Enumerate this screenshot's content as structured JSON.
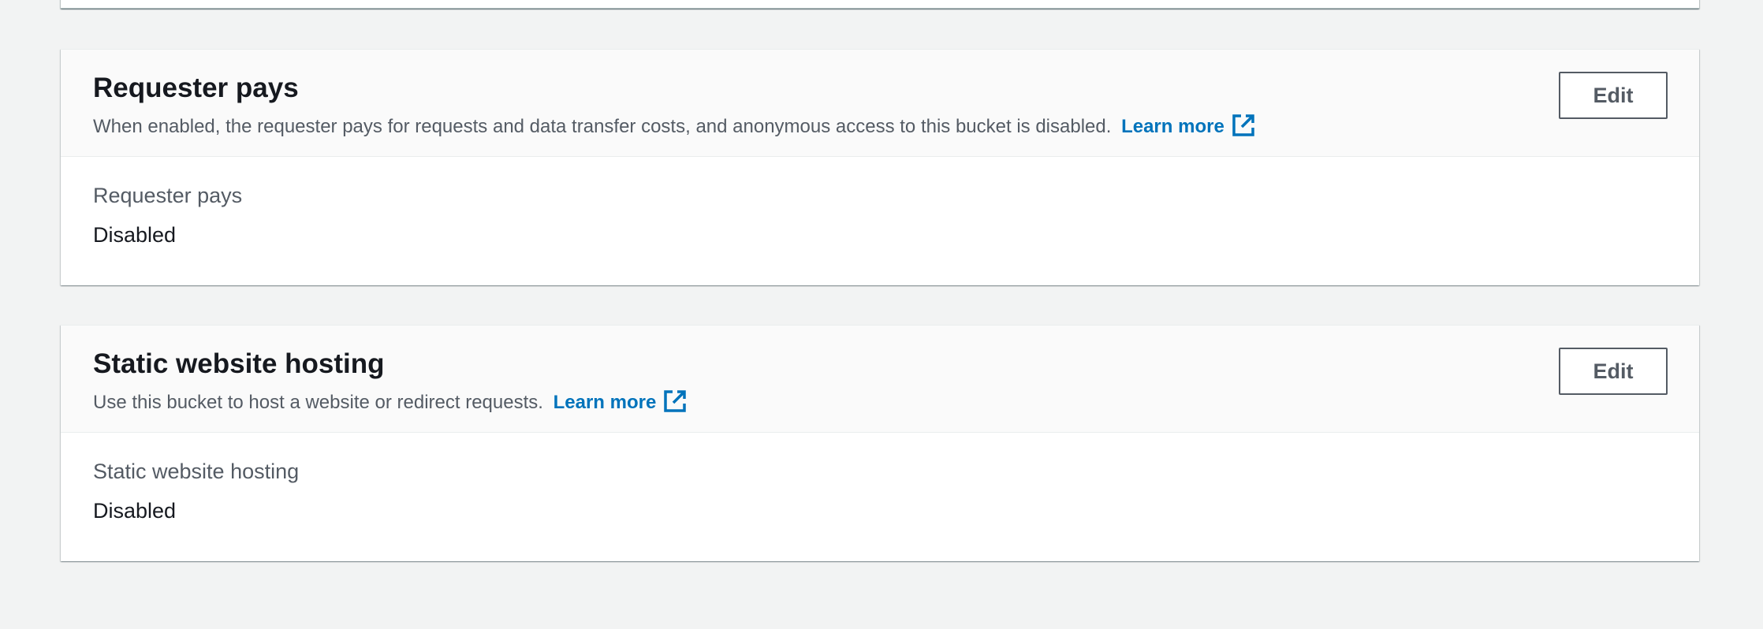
{
  "requester_pays": {
    "title": "Requester pays",
    "description": "When enabled, the requester pays for requests and data transfer costs, and anonymous access to this bucket is disabled.",
    "learn_more": "Learn more",
    "edit_label": "Edit",
    "field_label": "Requester pays",
    "field_value": "Disabled"
  },
  "static_website_hosting": {
    "title": "Static website hosting",
    "description": "Use this bucket to host a website or redirect requests.",
    "learn_more": "Learn more",
    "edit_label": "Edit",
    "field_label": "Static website hosting",
    "field_value": "Disabled"
  },
  "icons": {
    "external_link": "external-link-icon"
  },
  "colors": {
    "page_background": "#f2f3f3",
    "link": "#0073bb",
    "heading": "#16191f",
    "secondary_text": "#545b64"
  }
}
